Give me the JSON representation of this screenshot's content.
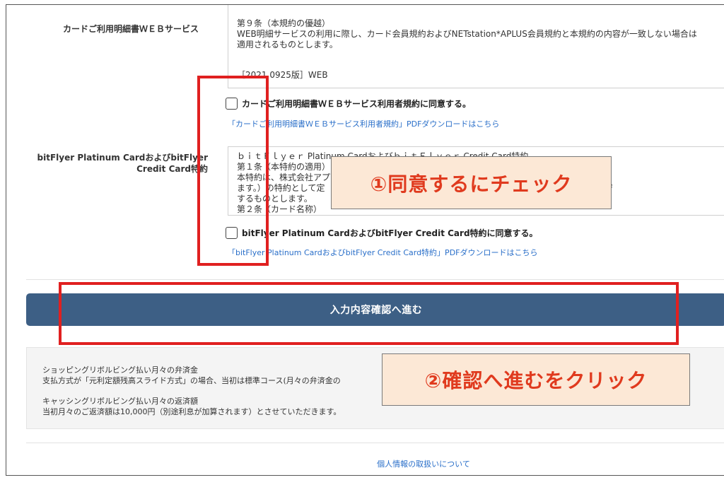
{
  "card_web": {
    "label": "カードご利用明細書ＷＥＢサービス",
    "terms_lines": [
      "第９条（本規約の優越）",
      "WEB明細サービスの利用に際し、カード会員規約およびNETstation*APLUS会員規約と本規約の内容が一致しない場合は",
      "適用されるものとします。"
    ],
    "terms_version": "［2021.0925版］WEB",
    "agree_label": "カードご利用明細書ＷＥＢサービス利用者規約に同意する。",
    "pdf_link": "「カードご利用明細書ＷＥＢサービス利用者規約」PDFダウンロードはこちら"
  },
  "bitflyer": {
    "label_line1": "bitFlyer Platinum CardおよびbitFlyer",
    "label_line2": "Credit Card特約",
    "terms_lines": [
      "ｂｉｔＦｌｙｅｒ Platinum CardおよびｂｉｔＦｌｙｅｒ Credit Card特約",
      "第１条（本特約の適用）",
      "本特約は、株式会社アプ　　　　　　　　　　　　　　　　　　　　　る会員規約（以下「クレジ",
      "ます。）の特約として定　　　　　　　　　　　　　　　　　　　　　がある場合のほかは、クレジ",
      "するものとします。",
      "第２条（カード名称）"
    ],
    "agree_label": "bitFlyer Platinum CardおよびbitFlyer Credit Card特約に同意する。",
    "pdf_link": "「bitFlyer Platinum CardおよびbitFlyer Credit Card特約」PDFダウンロードはこちら"
  },
  "confirm_button": "入力内容確認へ進む",
  "info": {
    "shopping_title": "ショッピングリボルビング払い月々の弁済金",
    "shopping_text": "支払方式が「元利定額残高スライド方式」の場合、当初は標準コース(月々の弁済金の",
    "cashing_title": "キャッシングリボルビング払い月々の返済額",
    "cashing_text": "当初月々のご返済額は10,000円（別途利息が加算されます）とさせていただきます。"
  },
  "footer_link": "個人情報の取扱いについて",
  "annotations": {
    "step1": "①同意するにチェック",
    "step2": "②確認へ進むをクリック",
    "highlight_color": "#e02020"
  }
}
